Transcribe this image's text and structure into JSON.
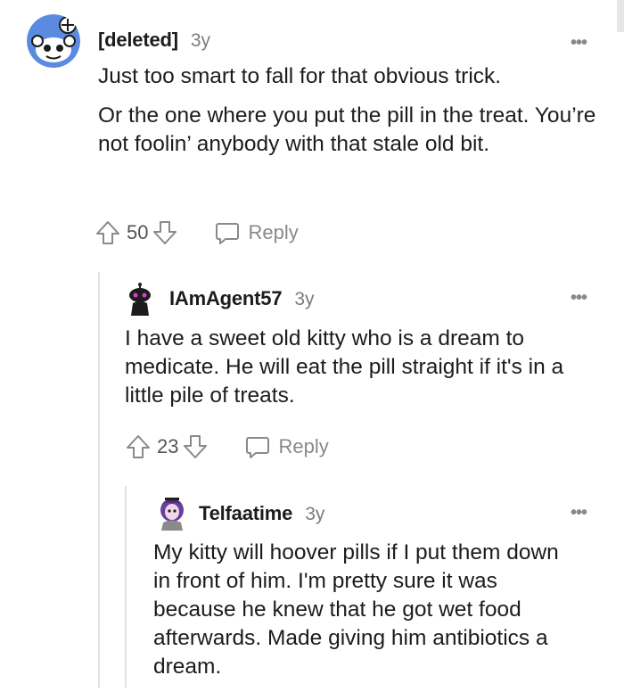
{
  "comments": [
    {
      "author": "[deleted]",
      "age": "3y",
      "paragraphs": [
        "Just too smart to fall for that obvious trick.",
        "Or the one where you put the pill in the treat. You’re not foolin’ anybody with that stale old bit."
      ],
      "score": "50",
      "reply_label": "Reply",
      "more_label": "•••"
    },
    {
      "author": "IAmAgent57",
      "age": "3y",
      "paragraphs": [
        "I have a sweet old kitty who is a dream to medicate. He will eat the pill straight if it's in a little pile of treats."
      ],
      "score": "23",
      "reply_label": "Reply",
      "more_label": "•••"
    },
    {
      "author": "Telfaatime",
      "age": "3y",
      "paragraphs": [
        "My kitty will hoover pills if I put them down in front of him. I'm pretty sure it was because he knew that he got wet food afterwards. Made giving him antibiotics a dream."
      ],
      "more_label": "•••"
    }
  ],
  "colors": {
    "text": "#1c1c1c",
    "muted": "#878a8c",
    "thread_line": "#e3e3e3",
    "avatar_blue": "#5b8be0"
  },
  "icons": [
    "snoo-avatar-icon",
    "agent-avatar-icon",
    "telfaatime-avatar-icon",
    "upvote-icon",
    "downvote-icon",
    "comment-bubble-icon",
    "more-options-icon"
  ]
}
